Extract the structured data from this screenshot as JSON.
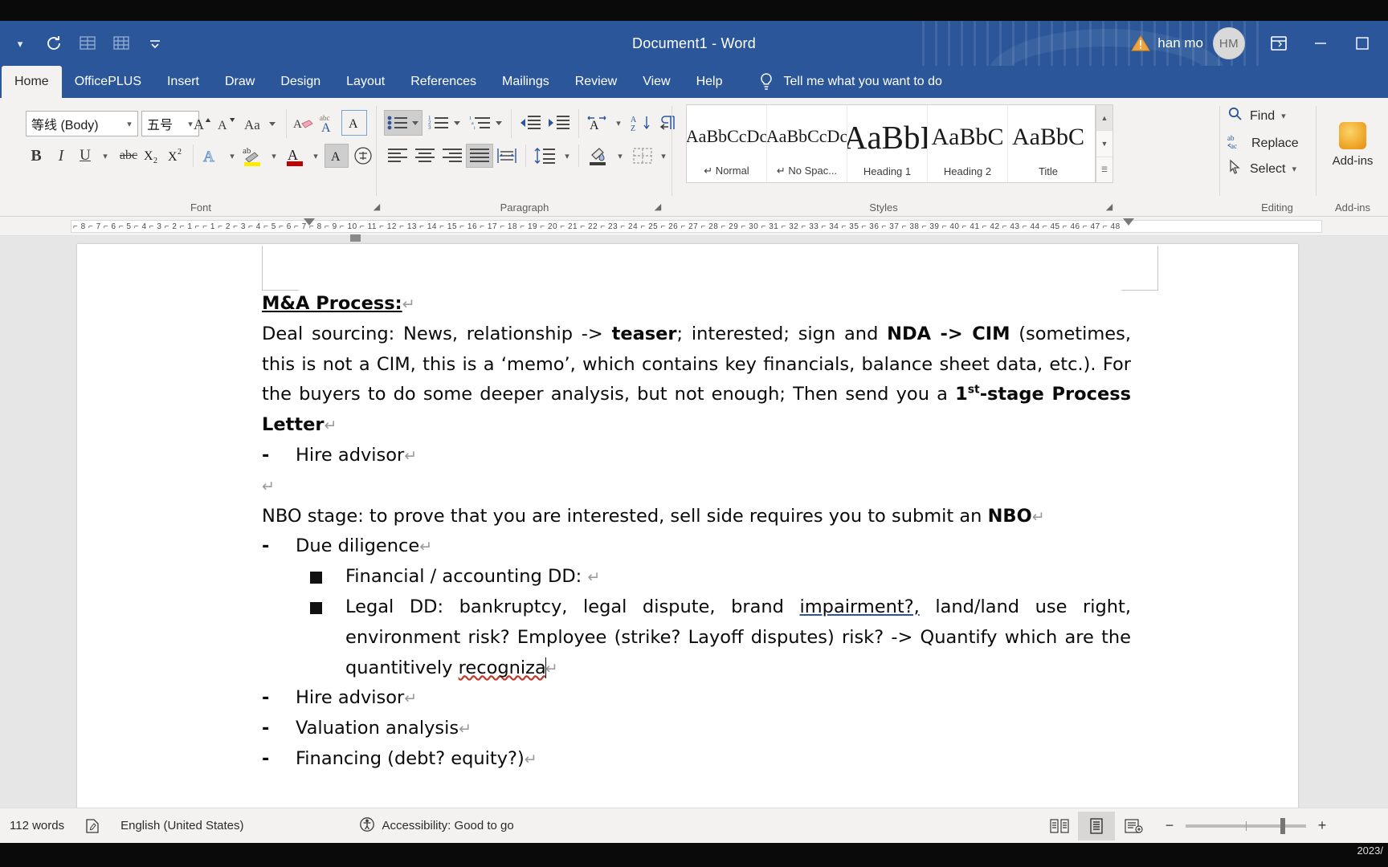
{
  "window": {
    "title": "Document1  -  Word",
    "user_name": "han mo",
    "user_initials": "HM",
    "accent_color": "#2b579a"
  },
  "quick_access": {
    "customize_label": "Customize Quick Access Toolbar",
    "items": [
      {
        "name": "undo-icon",
        "label": "Undo"
      },
      {
        "name": "table-grid-icon",
        "label": "Draw Table"
      },
      {
        "name": "table-grid2-icon",
        "label": "Insert Table"
      },
      {
        "name": "more-commands-icon",
        "label": "More"
      }
    ]
  },
  "window_controls": {
    "restore_label": "Restore Down",
    "minimize_label": "Minimize",
    "maximize_label": "Maximize",
    "ribbon_display_label": "Ribbon Display Options"
  },
  "tabs": [
    {
      "label": "Home",
      "active": true
    },
    {
      "label": "OfficePLUS",
      "active": false
    },
    {
      "label": "Insert",
      "active": false
    },
    {
      "label": "Draw",
      "active": false
    },
    {
      "label": "Design",
      "active": false
    },
    {
      "label": "Layout",
      "active": false
    },
    {
      "label": "References",
      "active": false
    },
    {
      "label": "Mailings",
      "active": false
    },
    {
      "label": "Review",
      "active": false
    },
    {
      "label": "View",
      "active": false
    },
    {
      "label": "Help",
      "active": false
    }
  ],
  "tell_me": {
    "label": "Tell me what you want to do",
    "icon": "lightbulb-icon"
  },
  "ribbon": {
    "groups": [
      {
        "key": "font",
        "label": "Font"
      },
      {
        "key": "paragraph",
        "label": "Paragraph"
      },
      {
        "key": "styles",
        "label": "Styles"
      },
      {
        "key": "editing",
        "label": "Editing"
      },
      {
        "key": "addins",
        "label": "Add-ins"
      }
    ],
    "font": {
      "font_name": "等线 (Body)",
      "font_size": "五号",
      "grow_font": "Grow Font",
      "shrink_font": "Shrink Font",
      "change_case": "Change Case",
      "clear_formatting": "Clear All Formatting",
      "phonetic_guide": "Phonetic Guide",
      "character_border": "Character Border",
      "bold": "B",
      "italic": "I",
      "underline": "U",
      "strikethrough": "abc",
      "subscript": "X₂",
      "superscript": "X²",
      "text_effects": "Text Effects and Typography",
      "highlight": "Text Highlight Color",
      "font_color": "Font Color",
      "character_shading": "Character Shading",
      "enclose_characters": "Enclose Characters"
    },
    "paragraph": {
      "bullets": "Bullets",
      "numbering": "Numbering",
      "multilevel_list": "Multilevel List",
      "decrease_indent": "Decrease Indent",
      "increase_indent": "Increase Indent",
      "asian_layout": "Asian Layout",
      "sort": "Sort",
      "show_marks": "Show/Hide ¶",
      "align_left": "Align Left",
      "align_center": "Center",
      "align_right": "Align Right",
      "justify": "Justify",
      "distributed": "Distributed",
      "line_spacing": "Line and Paragraph Spacing",
      "shading": "Shading",
      "borders": "Borders"
    },
    "styles": {
      "items": [
        {
          "preview": "AaBbCcDc",
          "name": "↵ Normal",
          "size": 22
        },
        {
          "preview": "AaBbCcDc",
          "name": "↵ No Spac...",
          "size": 22
        },
        {
          "preview": "AaBbI",
          "name": "Heading 1",
          "size": 40
        },
        {
          "preview": "AaBbC",
          "name": "Heading 2",
          "size": 30
        },
        {
          "preview": "AaBbC",
          "name": "Title",
          "size": 30
        }
      ],
      "scroll_up": "▲",
      "scroll_down": "▼",
      "more": "▼"
    },
    "editing": {
      "find": "Find",
      "replace": "Replace",
      "select": "Select"
    },
    "addins": {
      "label": "Add-ins"
    }
  },
  "ruler": {
    "marks": "⌐ 8 ⌐ 7 ⌐ 6 ⌐ 5 ⌐ 4 ⌐ 3 ⌐ 2 ⌐ 1 ⌐   ⌐ 1 ⌐ 2 ⌐ 3 ⌐ 4 ⌐ 5 ⌐ 6 ⌐ 7 ⌐ 8 ⌐ 9 ⌐ 10 ⌐ 11 ⌐ 12 ⌐ 13 ⌐ 14 ⌐ 15 ⌐ 16 ⌐ 17 ⌐ 18 ⌐ 19 ⌐ 20 ⌐ 21 ⌐ 22 ⌐ 23 ⌐ 24 ⌐ 25 ⌐ 26 ⌐ 27 ⌐ 28 ⌐ 29 ⌐ 30 ⌐ 31 ⌐ 32 ⌐ 33 ⌐ 34 ⌐ 35 ⌐ 36 ⌐ 37 ⌐ 38 ⌐ 39 ⌐ 40 ⌐ 41 ⌐ 42 ⌐ 43 ⌐ 44 ⌐ 45 ⌐ 46 ⌐ 47 ⌐ 48"
  },
  "document": {
    "heading": "M&A Process:",
    "pilcrow": "↵",
    "paragraphs": {
      "deal_sourcing": {
        "seg1": "Deal sourcing: News, relationship -> ",
        "bold1": "teaser",
        "seg2": "; interested; sign and ",
        "bold2": "NDA -> CIM",
        "seg3": " (sometimes, this is not a CIM, this is a ‘memo’, which contains key financials, balance sheet data, etc.). For the buyers to do some deeper analysis, but not enough; Then send you a ",
        "bold3_pre": "1",
        "bold3_sup": "st",
        "bold3_post": "-stage Process Letter"
      },
      "hire_advisor_1": "Hire advisor",
      "empty_line": "",
      "nbo_stage": {
        "seg1": "NBO stage: to prove that you are interested, sell side requires you to submit an ",
        "bold1": "NBO"
      },
      "due_diligence": "Due diligence",
      "financial_dd": "Financial / accounting DD: ",
      "legal_dd": {
        "seg1": "Legal DD: bankruptcy, legal dispute, brand ",
        "underlined": "impairment?,",
        "seg2": " land/land use right, environment risk? Employee (strike? Layoff disputes) risk? -> Quantify which are the quantitively ",
        "misspelled": "recogniza"
      },
      "hire_advisor_2": "Hire advisor",
      "valuation_analysis": "Valuation analysis",
      "financing": "Financing (debt? equity?)"
    },
    "bullet_dash": "-",
    "bullet_square": "■"
  },
  "status_bar": {
    "word_count": "112 words",
    "proofing_icon": "proofing-errors-icon",
    "language": "English (United States)",
    "accessibility_icon": "accessibility-icon",
    "accessibility": "Accessibility: Good to go",
    "views": [
      {
        "name": "read-mode-view",
        "label": "Read Mode",
        "active": false
      },
      {
        "name": "print-layout-view",
        "label": "Print Layout",
        "active": true
      },
      {
        "name": "web-layout-view",
        "label": "Web Layout",
        "active": false
      }
    ],
    "zoom_out": "−",
    "zoom_in": "+",
    "zoom_level": ""
  },
  "desktop": {
    "clock": "2023/"
  }
}
